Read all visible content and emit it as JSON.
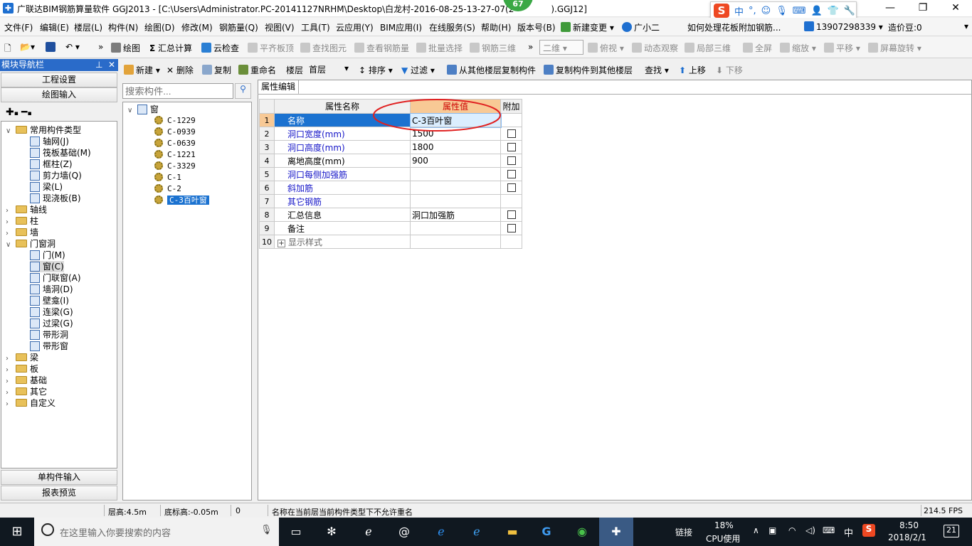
{
  "window": {
    "title": "广联达BIM钢筋算量软件 GGJ2013 - [C:\\Users\\Administrator.PC-20141127NRHM\\Desktop\\白龙村-2016-08-25-13-27-07(2",
    "title_suffix": ").GGJ12]",
    "badge": "67",
    "min_icon": "minimize-icon",
    "restore_icon": "restore-icon",
    "close_icon": "close-icon"
  },
  "ime": {
    "logo": "S",
    "lang": "中",
    "items": [
      "°,",
      "☺",
      "mic-icon",
      "keyboard-icon",
      "user-icon",
      "shirt-icon",
      "wrench-icon"
    ]
  },
  "menu": {
    "items": [
      "文件(F)",
      "编辑(E)",
      "楼层(L)",
      "构件(N)",
      "绘图(D)",
      "修改(M)",
      "钢筋量(Q)",
      "视图(V)",
      "工具(T)",
      "云应用(Y)",
      "BIM应用(I)",
      "在线服务(S)",
      "帮助(H)",
      "版本号(B)"
    ],
    "new_change": "新建变更",
    "assistant": "广小二",
    "question": "如何处理花板附加钢筋...",
    "phone": "13907298339",
    "price": "造价豆:0"
  },
  "toolbar": {
    "draw": "绘图",
    "sum": "汇总计算",
    "cloud_check": "云检查",
    "align_top": "平齐板顶",
    "find_elem": "查找图元",
    "view_rebar": "查看钢筋量",
    "batch_select": "批量选择",
    "rebar_3d": "钢筋三维",
    "view_mode": "二维",
    "top_view": "俯视",
    "dynamic_view": "动态观察",
    "local_3d": "局部三维",
    "fullscreen": "全屏",
    "zoom": "缩放",
    "pan": "平移",
    "rotate": "屏幕旋转"
  },
  "nav": {
    "header": "模块导航栏",
    "pin": "ⅹ",
    "project_settings": "工程设置",
    "drawing_input": "绘图输入",
    "single_input": "单构件输入",
    "report_preview": "报表预览",
    "tree": [
      {
        "label": "常用构件类型",
        "level": 0,
        "type": "folder",
        "open": true
      },
      {
        "label": "轴网(J)",
        "level": 1,
        "type": "item"
      },
      {
        "label": "筏板基础(M)",
        "level": 1,
        "type": "item"
      },
      {
        "label": "框柱(Z)",
        "level": 1,
        "type": "item"
      },
      {
        "label": "剪力墙(Q)",
        "level": 1,
        "type": "item"
      },
      {
        "label": "梁(L)",
        "level": 1,
        "type": "item"
      },
      {
        "label": "现浇板(B)",
        "level": 1,
        "type": "item"
      },
      {
        "label": "轴线",
        "level": 0,
        "type": "folder",
        "open": false
      },
      {
        "label": "柱",
        "level": 0,
        "type": "folder",
        "open": false
      },
      {
        "label": "墙",
        "level": 0,
        "type": "folder",
        "open": false
      },
      {
        "label": "门窗洞",
        "level": 0,
        "type": "folder",
        "open": true
      },
      {
        "label": "门(M)",
        "level": 1,
        "type": "item"
      },
      {
        "label": "窗(C)",
        "level": 1,
        "type": "item",
        "selected": true
      },
      {
        "label": "门联窗(A)",
        "level": 1,
        "type": "item"
      },
      {
        "label": "墙洞(D)",
        "level": 1,
        "type": "item"
      },
      {
        "label": "壁龛(I)",
        "level": 1,
        "type": "item"
      },
      {
        "label": "连梁(G)",
        "level": 1,
        "type": "item"
      },
      {
        "label": "过梁(G)",
        "level": 1,
        "type": "item"
      },
      {
        "label": "带形洞",
        "level": 1,
        "type": "item"
      },
      {
        "label": "带形窗",
        "level": 1,
        "type": "item"
      },
      {
        "label": "梁",
        "level": 0,
        "type": "folder",
        "open": false
      },
      {
        "label": "板",
        "level": 0,
        "type": "folder",
        "open": false
      },
      {
        "label": "基础",
        "level": 0,
        "type": "folder",
        "open": false
      },
      {
        "label": "其它",
        "level": 0,
        "type": "folder",
        "open": false
      },
      {
        "label": "自定义",
        "level": 0,
        "type": "folder",
        "open": false
      }
    ]
  },
  "subtoolbar": {
    "new": "新建",
    "delete": "删除",
    "copy": "复制",
    "rename": "重命名",
    "floor_label": "楼层",
    "floor_value": "首层",
    "sort": "排序",
    "filter": "过滤",
    "copy_from": "从其他楼层复制构件",
    "copy_to": "复制构件到其他楼层",
    "find": "查找",
    "move_up": "上移",
    "move_down": "下移"
  },
  "components": {
    "search_placeholder": "搜索构件...",
    "root": "窗",
    "items": [
      "C-1229",
      "C-0939",
      "C-0639",
      "C-1221",
      "C-3329",
      "C-1",
      "C-2",
      "C-3百叶窗"
    ],
    "selected_index": 7
  },
  "props": {
    "tab": "属性编辑",
    "col_name": "属性名称",
    "col_value": "属性值",
    "col_extra": "附加",
    "rows": [
      {
        "n": "1",
        "name": "名称",
        "value": "C-3百叶窗",
        "blue": false,
        "check": false,
        "selected": true
      },
      {
        "n": "2",
        "name": "洞口宽度(mm)",
        "value": "1500",
        "blue": true,
        "check": true
      },
      {
        "n": "3",
        "name": "洞口高度(mm)",
        "value": "1800",
        "blue": true,
        "check": true
      },
      {
        "n": "4",
        "name": "离地高度(mm)",
        "value": "900",
        "blue": false,
        "check": true
      },
      {
        "n": "5",
        "name": "洞口每侧加强筋",
        "value": "",
        "blue": true,
        "check": true
      },
      {
        "n": "6",
        "name": "斜加筋",
        "value": "",
        "blue": true,
        "check": true
      },
      {
        "n": "7",
        "name": "其它钢筋",
        "value": "",
        "blue": true,
        "check": false
      },
      {
        "n": "8",
        "name": "汇总信息",
        "value": "洞口加强筋",
        "blue": false,
        "check": true
      },
      {
        "n": "9",
        "name": "备注",
        "value": "",
        "blue": false,
        "check": true
      },
      {
        "n": "10",
        "name": "显示样式",
        "value": "",
        "blue": false,
        "check": false,
        "grey": true,
        "expander": true
      }
    ]
  },
  "status": {
    "floor_height": "层高:4.5m",
    "base_height": "底标高:-0.05m",
    "zero": "0",
    "message": "名称在当前层当前构件类型下不允许重名",
    "fps": "214.5 FPS"
  },
  "taskbar": {
    "search_placeholder": "在这里输入你要搜索的内容",
    "link": "链接",
    "cpu_pct": "18%",
    "cpu_label": "CPU使用",
    "ime": "中",
    "time": "8:50",
    "date": "2018/2/1",
    "notif": "21"
  }
}
